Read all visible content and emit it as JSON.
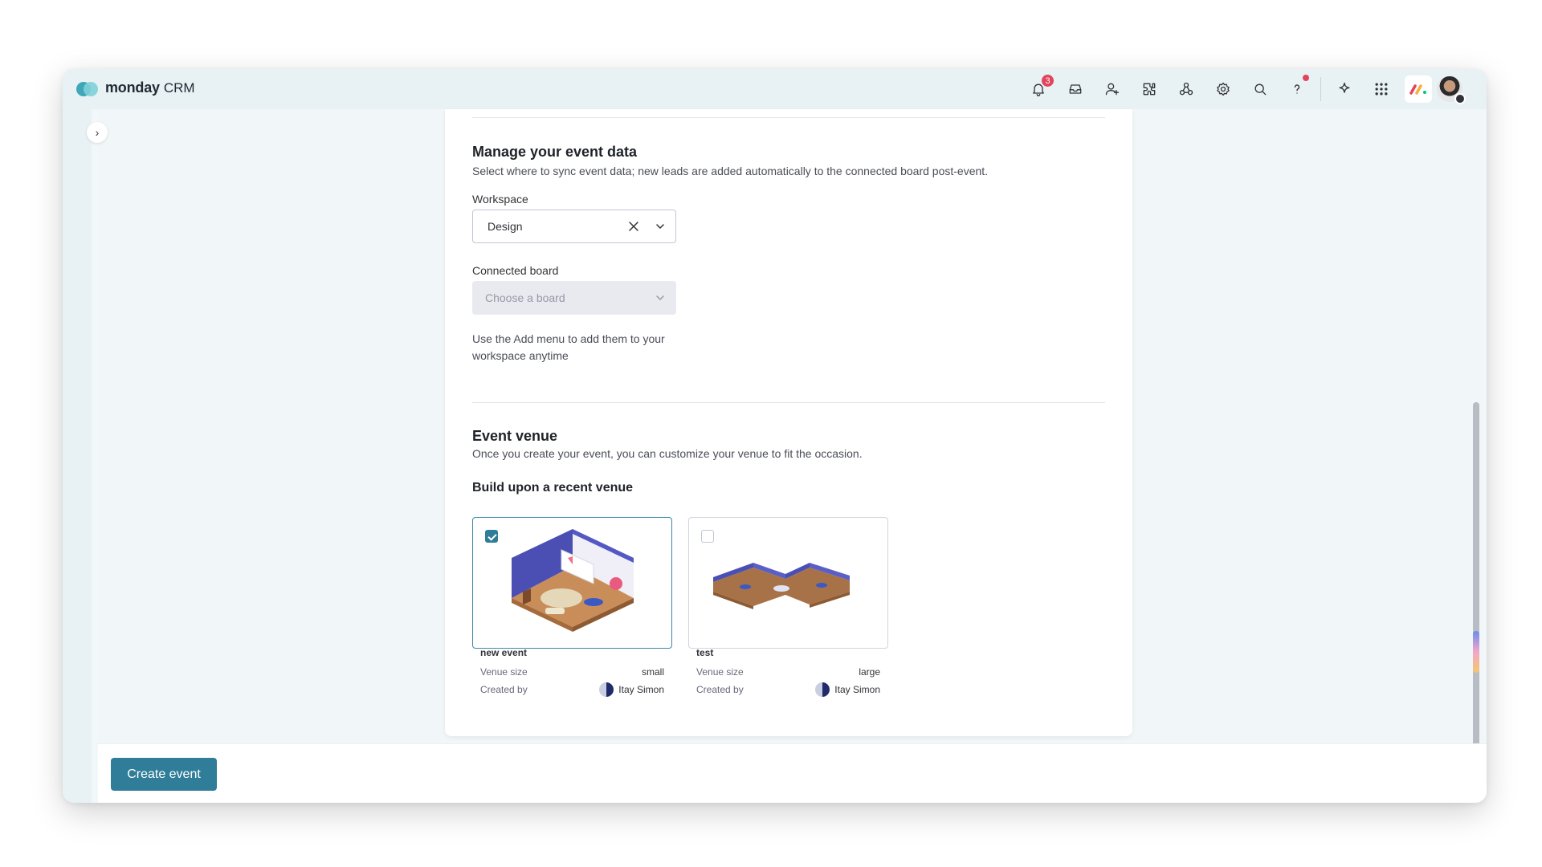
{
  "brand": {
    "name": "monday",
    "product": "CRM"
  },
  "header": {
    "notifications_count": "3",
    "icons": [
      "bell-icon",
      "inbox-icon",
      "invite-user-icon",
      "apps-icon",
      "integrations-icon",
      "settings-icon",
      "search-icon",
      "help-icon",
      "ai-sparkle-icon",
      "app-switcher-icon"
    ]
  },
  "manage": {
    "title": "Manage your event data",
    "description": "Select where to sync event data; new leads are added automatically to the connected board post-event.",
    "workspace_label": "Workspace",
    "workspace_value": "Design",
    "board_label": "Connected board",
    "board_placeholder": "Choose a board",
    "hint": "Use the Add menu to add them to your workspace anytime"
  },
  "venue": {
    "title": "Event venue",
    "description": "Once you create your event, you can customize your venue to fit the occasion.",
    "subtitle": "Build upon a recent venue",
    "cards": [
      {
        "name": "new event",
        "size_label": "Venue size",
        "size": "small",
        "created_label": "Created by",
        "creator": "Itay Simon",
        "selected": true
      },
      {
        "name": "test",
        "size_label": "Venue size",
        "size": "large",
        "created_label": "Created by",
        "creator": "Itay Simon",
        "selected": false
      }
    ]
  },
  "footer": {
    "create_label": "Create event"
  },
  "colors": {
    "primary": "#2f7d98",
    "badge": "#e2445c",
    "app_bg": "#e8f1f4"
  }
}
